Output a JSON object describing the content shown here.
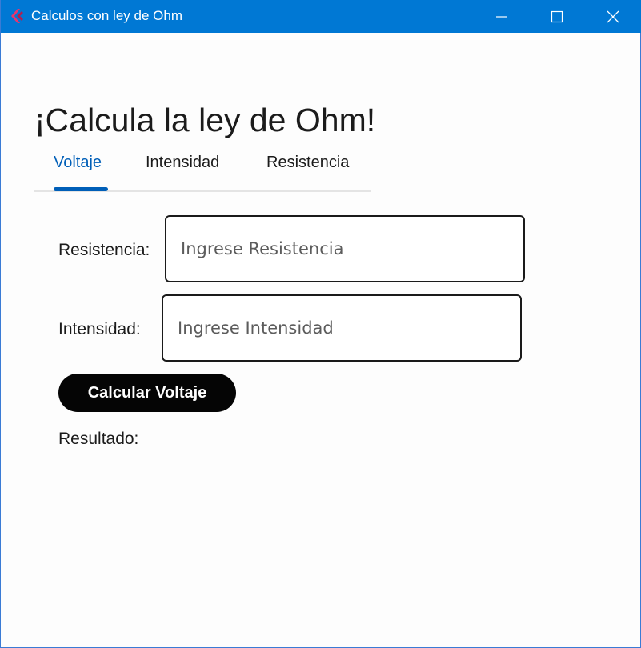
{
  "window": {
    "title": "Calculos con ley de Ohm",
    "controls": [
      "minimize-icon",
      "maximize-icon",
      "close-icon"
    ],
    "accent_color": "#0078d4"
  },
  "heading": "¡Calcula la ley de Ohm!",
  "tabs": {
    "items": [
      {
        "label": "Voltaje",
        "selected": true
      },
      {
        "label": "Intensidad",
        "selected": false
      },
      {
        "label": "Resistencia",
        "selected": false
      }
    ],
    "selected_color": "#005fb8"
  },
  "form": {
    "resistencia": {
      "label": "Resistencia:",
      "value": "",
      "placeholder": "Ingrese Resistencia"
    },
    "intensidad": {
      "label": "Intensidad:",
      "value": "",
      "placeholder": "Ingrese Intensidad"
    },
    "button_label": "Calcular Voltaje",
    "result_label": "Resultado:"
  }
}
